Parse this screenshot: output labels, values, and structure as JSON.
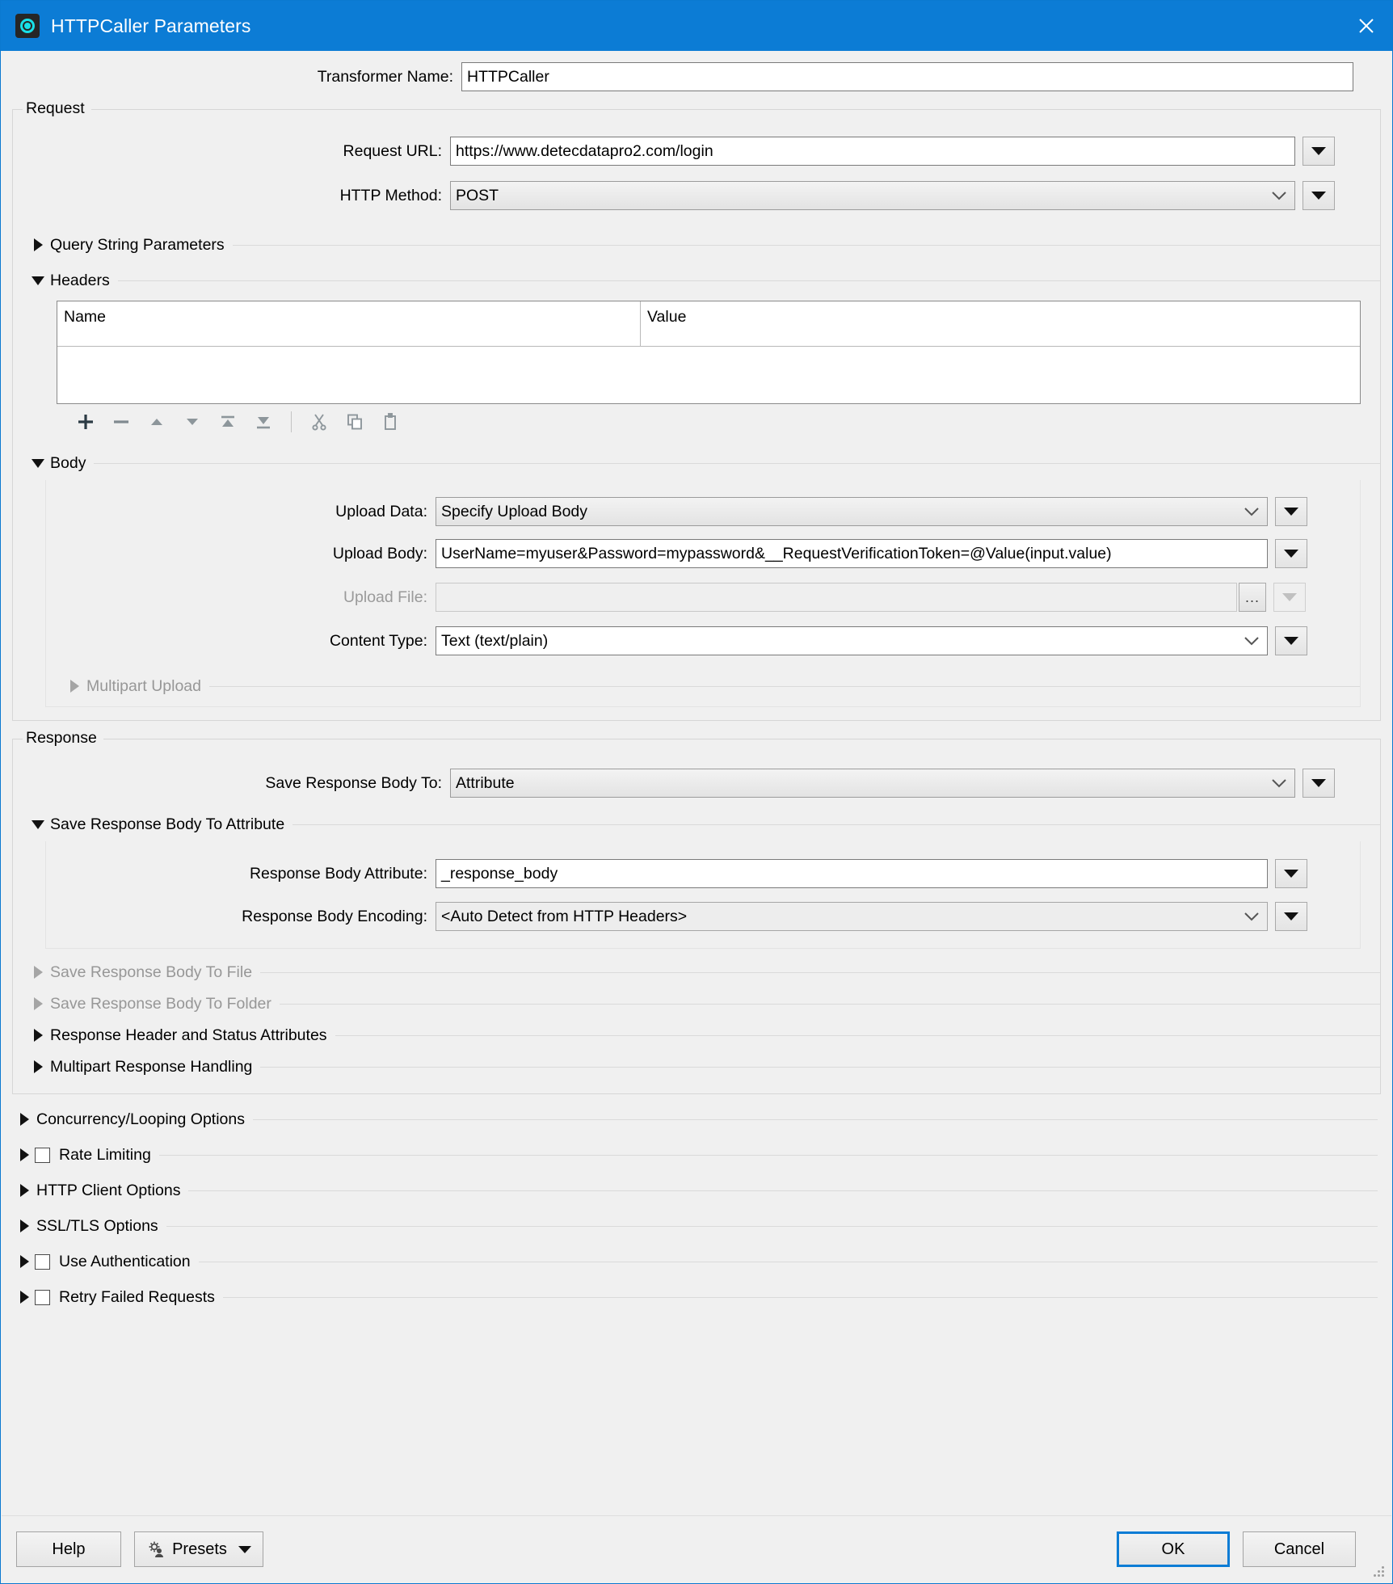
{
  "window": {
    "title": "HTTPCaller Parameters",
    "icon": "http-caller-icon",
    "close_icon": "close-icon",
    "accent_color": "#0c7cd5"
  },
  "transformer": {
    "label": "Transformer Name:",
    "value": "HTTPCaller"
  },
  "request": {
    "group_title": "Request",
    "url": {
      "label": "Request URL:",
      "value": "https://www.detecdatapro2.com/login"
    },
    "method": {
      "label": "HTTP Method:",
      "value": "POST"
    },
    "query_string_parameters": {
      "label": "Query String Parameters",
      "expanded": false
    },
    "headers": {
      "label": "Headers",
      "expanded": true,
      "columns": [
        "Name",
        "Value"
      ],
      "rows": [],
      "toolbar": [
        {
          "name": "add-row-button",
          "icon": "plus-icon"
        },
        {
          "name": "remove-row-button",
          "icon": "minus-icon"
        },
        {
          "name": "move-up-button",
          "icon": "arrow-up-icon"
        },
        {
          "name": "move-down-button",
          "icon": "arrow-down-icon"
        },
        {
          "name": "move-to-top-button",
          "icon": "move-to-top-icon"
        },
        {
          "name": "move-to-bottom-button",
          "icon": "move-to-bottom-icon"
        },
        {
          "name": "cut-button",
          "icon": "scissors-icon"
        },
        {
          "name": "copy-button",
          "icon": "copy-icon"
        },
        {
          "name": "paste-button",
          "icon": "clipboard-icon"
        }
      ]
    },
    "body": {
      "label": "Body",
      "expanded": true,
      "upload_data": {
        "label": "Upload Data:",
        "value": "Specify Upload Body"
      },
      "upload_body": {
        "label": "Upload Body:",
        "value": "UserName=myuser&Password=mypassword&__RequestVerificationToken=@Value(input.value)"
      },
      "upload_file": {
        "label": "Upload File:",
        "value": "",
        "disabled": true,
        "browse_label": "..."
      },
      "content_type": {
        "label": "Content Type:",
        "value": "Text (text/plain)"
      },
      "multipart_upload": {
        "label": "Multipart Upload",
        "expanded": false,
        "disabled": true
      }
    }
  },
  "response": {
    "group_title": "Response",
    "save_body_to": {
      "label": "Save Response Body To:",
      "value": "Attribute"
    },
    "save_to_attribute": {
      "label": "Save Response Body To Attribute",
      "expanded": true,
      "body_attribute": {
        "label": "Response Body Attribute:",
        "value": "_response_body"
      },
      "body_encoding": {
        "label": "Response Body Encoding:",
        "value": "<Auto Detect from HTTP Headers>"
      }
    },
    "sections": [
      {
        "label": "Save Response Body To File",
        "expanded": false,
        "disabled": true
      },
      {
        "label": "Save Response Body To Folder",
        "expanded": false,
        "disabled": true
      },
      {
        "label": "Response Header and Status Attributes",
        "expanded": false,
        "disabled": false
      },
      {
        "label": "Multipart Response Handling",
        "expanded": false,
        "disabled": false
      }
    ]
  },
  "options": [
    {
      "label": "Concurrency/Looping Options",
      "checkbox": false,
      "checked": false
    },
    {
      "label": "Rate Limiting",
      "checkbox": true,
      "checked": false
    },
    {
      "label": "HTTP Client Options",
      "checkbox": false,
      "checked": false
    },
    {
      "label": "SSL/TLS Options",
      "checkbox": false,
      "checked": false
    },
    {
      "label": "Use Authentication",
      "checkbox": true,
      "checked": false
    },
    {
      "label": "Retry Failed Requests",
      "checkbox": true,
      "checked": false
    }
  ],
  "footer": {
    "help": "Help",
    "presets": "Presets",
    "presets_icon": "gear-user-icon",
    "ok": "OK",
    "cancel": "Cancel"
  }
}
